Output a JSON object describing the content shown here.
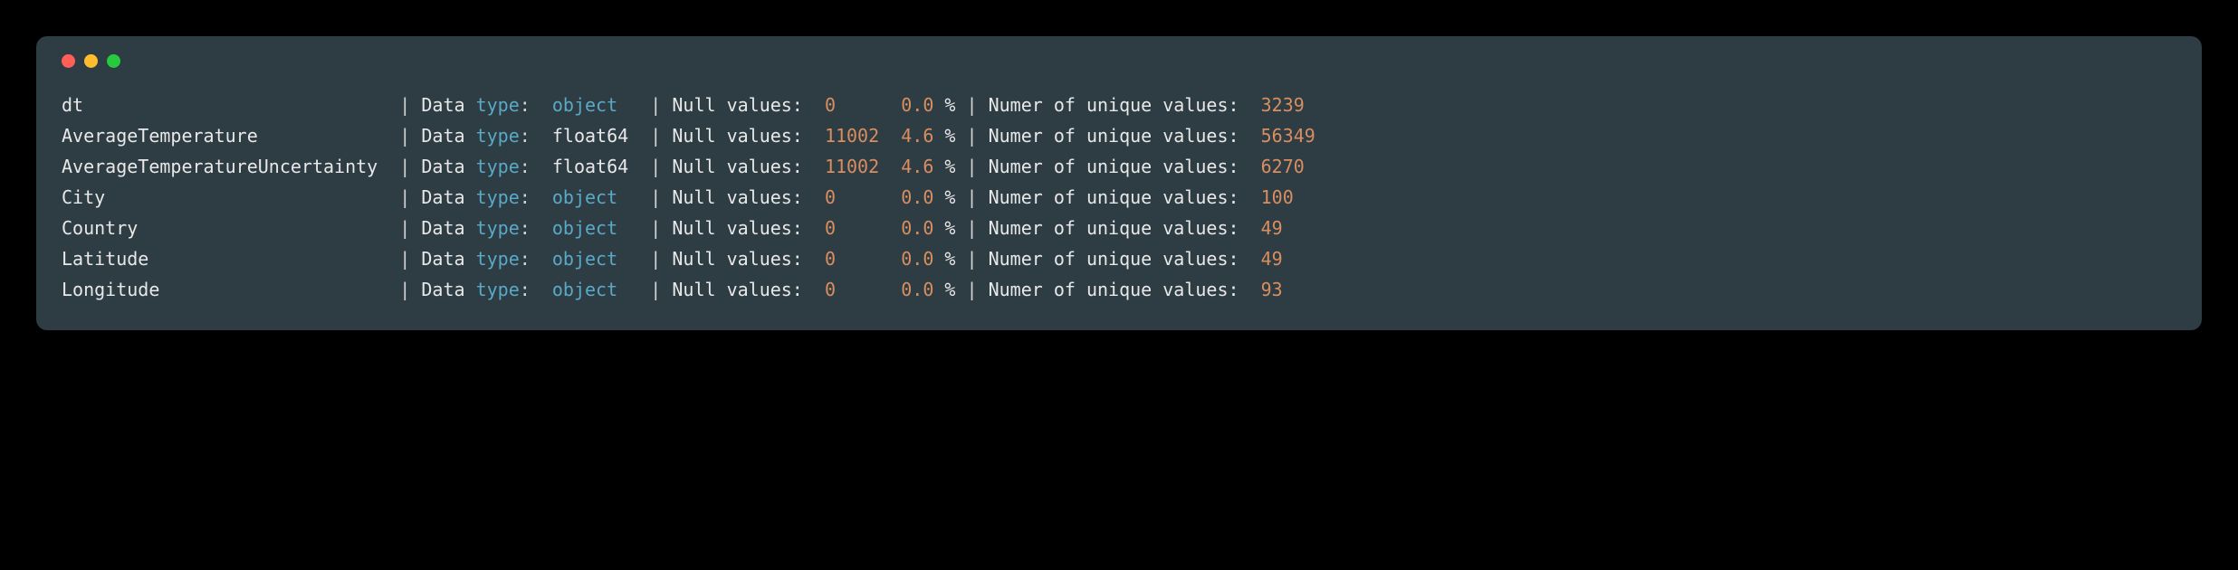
{
  "labels": {
    "data": "Data",
    "type": "type",
    "colon": ":",
    "null_values": "Null values:",
    "percent": "%",
    "unique_label": "Numer of unique values:",
    "sep": "|"
  },
  "rows": [
    {
      "name": "dt",
      "dtype": "object",
      "dtype_class": "dtype-object",
      "nulls": "0",
      "null_pct": "0.0",
      "unique": "3239"
    },
    {
      "name": "AverageTemperature",
      "dtype": "float64",
      "dtype_class": "dtype-float",
      "nulls": "11002",
      "null_pct": "4.6",
      "unique": "56349"
    },
    {
      "name": "AverageTemperatureUncertainty",
      "dtype": "float64",
      "dtype_class": "dtype-float",
      "nulls": "11002",
      "null_pct": "4.6",
      "unique": "6270"
    },
    {
      "name": "City",
      "dtype": "object",
      "dtype_class": "dtype-object",
      "nulls": "0",
      "null_pct": "0.0",
      "unique": "100"
    },
    {
      "name": "Country",
      "dtype": "object",
      "dtype_class": "dtype-object",
      "nulls": "0",
      "null_pct": "0.0",
      "unique": "49"
    },
    {
      "name": "Latitude",
      "dtype": "object",
      "dtype_class": "dtype-object",
      "nulls": "0",
      "null_pct": "0.0",
      "unique": "49"
    },
    {
      "name": "Longitude",
      "dtype": "object",
      "dtype_class": "dtype-object",
      "nulls": "0",
      "null_pct": "0.0",
      "unique": "93"
    }
  ],
  "widths": {
    "name": 31,
    "dtype": 9,
    "nulls": 7,
    "null_pct": 4
  }
}
